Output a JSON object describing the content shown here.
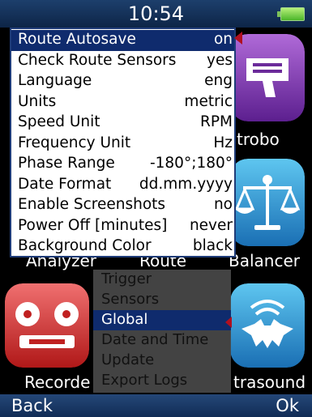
{
  "status_bar": {
    "time": "10:54",
    "battery_icon": "battery-full-icon"
  },
  "apps": [
    {
      "id": "strobo",
      "label": "trobo",
      "icon": "stroboscope-icon"
    },
    {
      "id": "analyzer",
      "label": "Analyzer",
      "icon": "analyzer-icon"
    },
    {
      "id": "route",
      "label": "Route",
      "icon": "route-icon"
    },
    {
      "id": "balancer",
      "label": "Balancer",
      "icon": "balance-scale-icon"
    },
    {
      "id": "recorder",
      "label": "Recorde",
      "icon": "tape-recorder-icon"
    },
    {
      "id": "ultrasound",
      "label": "trasound",
      "icon": "bat-ultrasound-icon"
    }
  ],
  "settings": {
    "items": [
      {
        "name": "Route Autosave",
        "value": "on"
      },
      {
        "name": "Check Route Sensors",
        "value": "yes"
      },
      {
        "name": "Language",
        "value": "eng"
      },
      {
        "name": "Units",
        "value": "metric"
      },
      {
        "name": "Speed Unit",
        "value": "RPM"
      },
      {
        "name": "Frequency Unit",
        "value": "Hz"
      },
      {
        "name": "Phase Range",
        "value": "-180°;180°"
      },
      {
        "name": "Date Format",
        "value": "dd.mm.yyyy"
      },
      {
        "name": "Enable Screenshots",
        "value": "no"
      },
      {
        "name": "Power Off [minutes]",
        "value": "never"
      },
      {
        "name": "Background Color",
        "value": "black"
      }
    ],
    "selected_index": 0
  },
  "menu": {
    "items": [
      "Trigger",
      "Sensors",
      "Global",
      "Date and Time",
      "Update",
      "Export Logs"
    ],
    "selected_index": 2
  },
  "softkeys": {
    "left": "Back",
    "right": "Ok"
  },
  "colors": {
    "selection": "#0f2b6d",
    "marker": "#b01020",
    "status_bar": "#1d3f6c"
  }
}
